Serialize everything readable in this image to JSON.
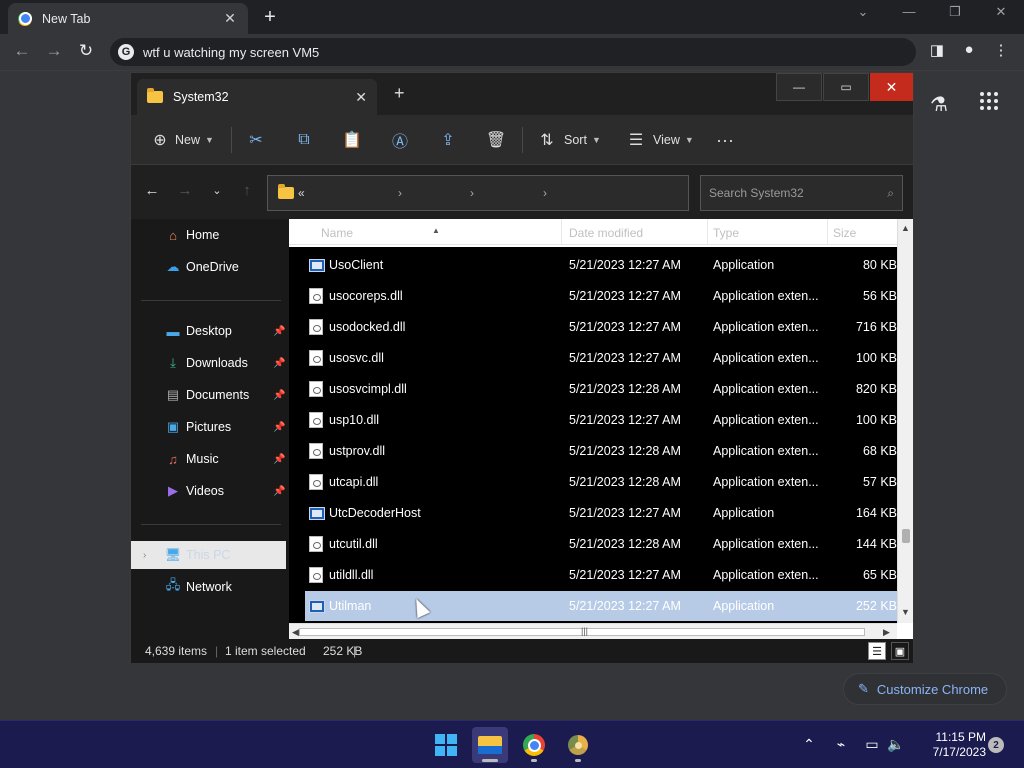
{
  "chrome": {
    "tab_title": "New Tab",
    "omnibox_text": "wtf u watching my screen VM5",
    "customize_label": "Customize Chrome"
  },
  "explorer": {
    "tab_title": "System32",
    "toolbar": {
      "new_label": "New",
      "sort_label": "Sort",
      "view_label": "View"
    },
    "address_prefix": "«",
    "search_placeholder": "Search System32",
    "nav": {
      "home": "Home",
      "onedrive": "OneDrive",
      "desktop": "Desktop",
      "downloads": "Downloads",
      "documents": "Documents",
      "pictures": "Pictures",
      "music": "Music",
      "videos": "Videos",
      "this_pc": "This PC",
      "network": "Network"
    },
    "columns": {
      "name": "Name",
      "date": "Date modified",
      "type": "Type",
      "size": "Size"
    },
    "files": [
      {
        "name": "UsoClient",
        "date": "5/21/2023 12:27 AM",
        "type": "Application",
        "size": "80 KB",
        "kind": "app"
      },
      {
        "name": "usocoreps.dll",
        "date": "5/21/2023 12:27 AM",
        "type": "Application exten...",
        "size": "56 KB",
        "kind": "dll"
      },
      {
        "name": "usodocked.dll",
        "date": "5/21/2023 12:27 AM",
        "type": "Application exten...",
        "size": "716 KB",
        "kind": "dll"
      },
      {
        "name": "usosvc.dll",
        "date": "5/21/2023 12:27 AM",
        "type": "Application exten...",
        "size": "100 KB",
        "kind": "dll"
      },
      {
        "name": "usosvcimpl.dll",
        "date": "5/21/2023 12:28 AM",
        "type": "Application exten...",
        "size": "820 KB",
        "kind": "dll"
      },
      {
        "name": "usp10.dll",
        "date": "5/21/2023 12:27 AM",
        "type": "Application exten...",
        "size": "100 KB",
        "kind": "dll"
      },
      {
        "name": "ustprov.dll",
        "date": "5/21/2023 12:28 AM",
        "type": "Application exten...",
        "size": "68 KB",
        "kind": "dll"
      },
      {
        "name": "utcapi.dll",
        "date": "5/21/2023 12:28 AM",
        "type": "Application exten...",
        "size": "57 KB",
        "kind": "dll"
      },
      {
        "name": "UtcDecoderHost",
        "date": "5/21/2023 12:27 AM",
        "type": "Application",
        "size": "164 KB",
        "kind": "app"
      },
      {
        "name": "utcutil.dll",
        "date": "5/21/2023 12:28 AM",
        "type": "Application exten...",
        "size": "144 KB",
        "kind": "dll"
      },
      {
        "name": "utildll.dll",
        "date": "5/21/2023 12:27 AM",
        "type": "Application exten...",
        "size": "65 KB",
        "kind": "dll"
      },
      {
        "name": "Utilman",
        "date": "5/21/2023 12:27 AM",
        "type": "Application",
        "size": "252 KB",
        "kind": "app",
        "selected": true
      }
    ],
    "status": {
      "count": "4,639 items",
      "selected": "1 item selected",
      "size": "252 KB"
    }
  },
  "taskbar": {
    "time": "11:15 PM",
    "date": "7/17/2023",
    "notifications": "2"
  }
}
